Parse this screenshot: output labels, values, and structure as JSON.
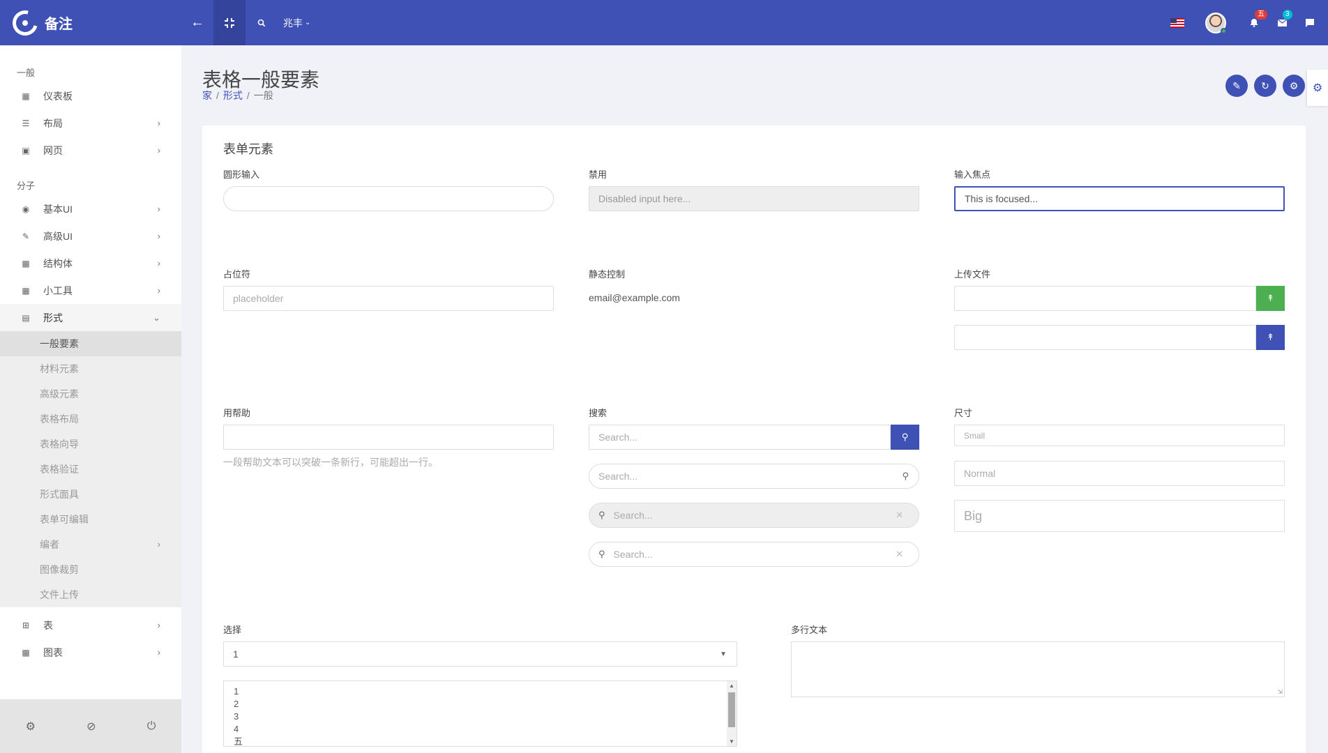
{
  "app": {
    "name": "备注"
  },
  "topbar": {
    "lang_label": "兆丰",
    "notif_count": "五",
    "mail_count": "3"
  },
  "sidebar": {
    "section_general": "一般",
    "items_general": [
      {
        "label": "仪表板",
        "icon": "dashboard-icon"
      },
      {
        "label": "布局",
        "icon": "layout-icon"
      },
      {
        "label": "网页",
        "icon": "pages-icon"
      }
    ],
    "section_molecules": "分子",
    "items_molecules": [
      {
        "label": "基本UI",
        "icon": "palette-icon"
      },
      {
        "label": "高级UI",
        "icon": "brush-icon"
      },
      {
        "label": "结构体",
        "icon": "puzzle-icon"
      },
      {
        "label": "小工具",
        "icon": "widgets-icon"
      },
      {
        "label": "形式",
        "icon": "form-icon"
      }
    ],
    "form_submenu": [
      "一般要素",
      "材料元素",
      "高级元素",
      "表格布局",
      "表格向导",
      "表格验证",
      "形式面具",
      "表单可编辑",
      "编者",
      "图像裁剪",
      "文件上传"
    ],
    "items_bottom": [
      {
        "label": "表",
        "icon": "table-icon"
      },
      {
        "label": "图表",
        "icon": "chart-icon"
      }
    ]
  },
  "page": {
    "title": "表格一般要素",
    "breadcrumb": [
      "家",
      "形式",
      "一般"
    ]
  },
  "card": {
    "title": "表单元素",
    "round_input": {
      "label": "圆形输入",
      "value": ""
    },
    "disabled": {
      "label": "禁用",
      "placeholder": "Disabled input here..."
    },
    "focus": {
      "label": "输入焦点",
      "value": "This is focused..."
    },
    "placeholder": {
      "label": "占位符",
      "placeholder": "placeholder"
    },
    "static_control": {
      "label": "静态控制",
      "value": "email@example.com"
    },
    "upload": {
      "label": "上传文件"
    },
    "help": {
      "label": "用帮助",
      "text": "一段帮助文本可以突破一条新行，可能超出一行。"
    },
    "search": {
      "label": "搜索",
      "placeholder": "Search..."
    },
    "size": {
      "label": "尺寸",
      "small": "Small",
      "normal": "Normal",
      "big": "Big"
    },
    "select": {
      "label": "选择",
      "value": "1",
      "options": [
        "1",
        "2",
        "3",
        "4",
        "五"
      ]
    },
    "textarea": {
      "label": "多行文本"
    }
  },
  "colors": {
    "primary": "#3f51b5",
    "success": "#4caf50",
    "danger": "#e53935",
    "info": "#00bcd4"
  }
}
